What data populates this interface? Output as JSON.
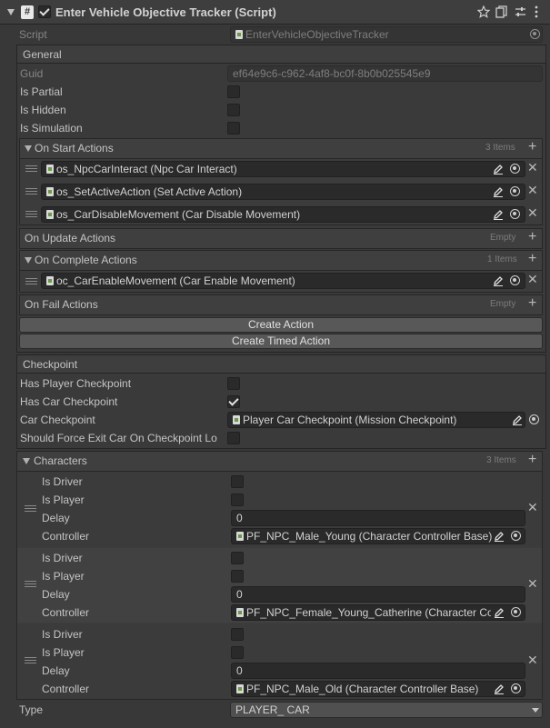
{
  "header": {
    "title": "Enter Vehicle Objective Tracker (Script)",
    "icons": [
      "hash-script-icon",
      "star-icon",
      "copy-icon",
      "sliders-icon",
      "more-icon"
    ]
  },
  "script": {
    "label": "Script",
    "value": "EnterVehicleObjectiveTracker"
  },
  "general": {
    "title": "General",
    "guid_label": "Guid",
    "guid_value": "ef64e9c6-c962-4af8-bc0f-8b0b025545e9",
    "is_partial": "Is Partial",
    "is_hidden": "Is Hidden",
    "is_simulation": "Is Simulation"
  },
  "on_start": {
    "title": "On Start Actions",
    "count": "3 Items",
    "items": [
      "os_NpcCarInteract (Npc Car Interact)",
      "os_SetActiveAction (Set Active Action)",
      "os_CarDisableMovement (Car Disable Movement)"
    ]
  },
  "on_update": {
    "title": "On Update Actions",
    "count": "Empty"
  },
  "on_complete": {
    "title": "On Complete Actions",
    "count": "1 Items",
    "items": [
      "oc_CarEnableMovement (Car Enable Movement)"
    ]
  },
  "on_fail": {
    "title": "On Fail Actions",
    "count": "Empty"
  },
  "buttons": {
    "create_action": "Create Action",
    "create_timed_action": "Create Timed Action"
  },
  "checkpoint": {
    "title": "Checkpoint",
    "has_player": "Has Player Checkpoint",
    "has_car": "Has Car Checkpoint",
    "car_checkpoint_label": "Car Checkpoint",
    "car_checkpoint_value": "Player Car Checkpoint (Mission Checkpoint)",
    "force_exit": "Should Force Exit Car On Checkpoint Lo"
  },
  "characters": {
    "title": "Characters",
    "count": "3 Items",
    "is_driver": "Is Driver",
    "is_player": "Is Player",
    "delay": "Delay",
    "controller": "Controller",
    "items": [
      {
        "delay": "0",
        "controller": "PF_NPC_Male_Young (Character Controller Base)"
      },
      {
        "delay": "0",
        "controller": "PF_NPC_Female_Young_Catherine (Character Controller Base)"
      },
      {
        "delay": "0",
        "controller": "PF_NPC_Male_Old (Character Controller Base)"
      }
    ]
  },
  "type": {
    "label": "Type",
    "value": "PLAYER_ CAR"
  }
}
